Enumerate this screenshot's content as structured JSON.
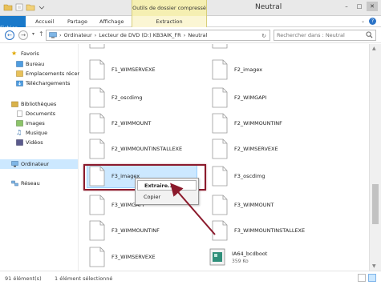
{
  "window": {
    "tools_label": "Outils de dossier compressé",
    "title": "Neutral"
  },
  "ribbon": {
    "tabs": [
      "Fichier",
      "Accueil",
      "Partage",
      "Affichage",
      "Extraction"
    ]
  },
  "address": {
    "path": [
      "Ordinateur",
      "Lecteur de DVD (D:) KB3AIK_FR",
      "Neutral"
    ],
    "search_placeholder": "Rechercher dans : Neutral"
  },
  "sidebar": {
    "favorites_header": "Favoris",
    "favorites": [
      "Bureau",
      "Emplacements récents",
      "Téléchargements"
    ],
    "libraries_header": "Bibliothèques",
    "libraries": [
      "Documents",
      "Images",
      "Musique",
      "Vidéos"
    ],
    "computer": "Ordinateur",
    "network": "Réseau"
  },
  "files": {
    "col1": [
      "F1_WIMSERVEXE",
      "F2_oscdimg",
      "F2_WIMMOUNT",
      "F2_WIMMOUNTINSTALLEXE",
      "F3_imagex",
      "F3_WIMGAPI",
      "F3_WIMMOUNTINF",
      "F3_WIMSERVEXE"
    ],
    "col2": [
      "F2_imagex",
      "F2_WIMGAPI",
      "F2_WIMMOUNTINF",
      "F2_WIMSERVEXE",
      "F3_oscdimg",
      "F3_WIMMOUNT",
      "F3_WIMMOUNTINSTALLEXE",
      "IA64_bcdboot"
    ],
    "col2_last_sub": "359 Ko"
  },
  "context_menu": {
    "items": [
      "Extraire...",
      "Copier"
    ]
  },
  "status": {
    "count": "91 élément(s)",
    "selection": "1 élément sélectionné"
  },
  "colors": {
    "file_tab": "#1979ca",
    "selection": "#cce8ff",
    "highlight_box": "#8b1a2c"
  }
}
